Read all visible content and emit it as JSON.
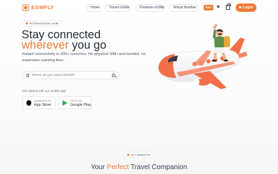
{
  "brand": {
    "name": "ESIMFLY",
    "accent_color": "#f47a35"
  },
  "nav": {
    "items": [
      "Home",
      "Travel eSIMs",
      "Premium eSIMs",
      "Virtual Number"
    ],
    "language": "ENG",
    "login_label": "Login"
  },
  "hero": {
    "badge": "INTERNATIONAL eSIM",
    "title_line1": "Stay connected",
    "title_accent": "wherever",
    "title_rest": " you go",
    "subtitle": "Instant connectivity in 200+ countries. No physical SIM card needed, no expensive roaming fees.",
    "search_placeholder": "Where do you need Internet?",
    "get_started": "Get started with our mobile app",
    "app_store": {
      "small": "Download on the",
      "big": "App Store"
    },
    "google_play": {
      "small": "GET IT ON",
      "big": "Google Play"
    }
  },
  "section": {
    "badge": "KEY BENEFITS",
    "title_pre": "Your ",
    "title_accent": "Perfect",
    "title_post": " Travel Companion"
  }
}
